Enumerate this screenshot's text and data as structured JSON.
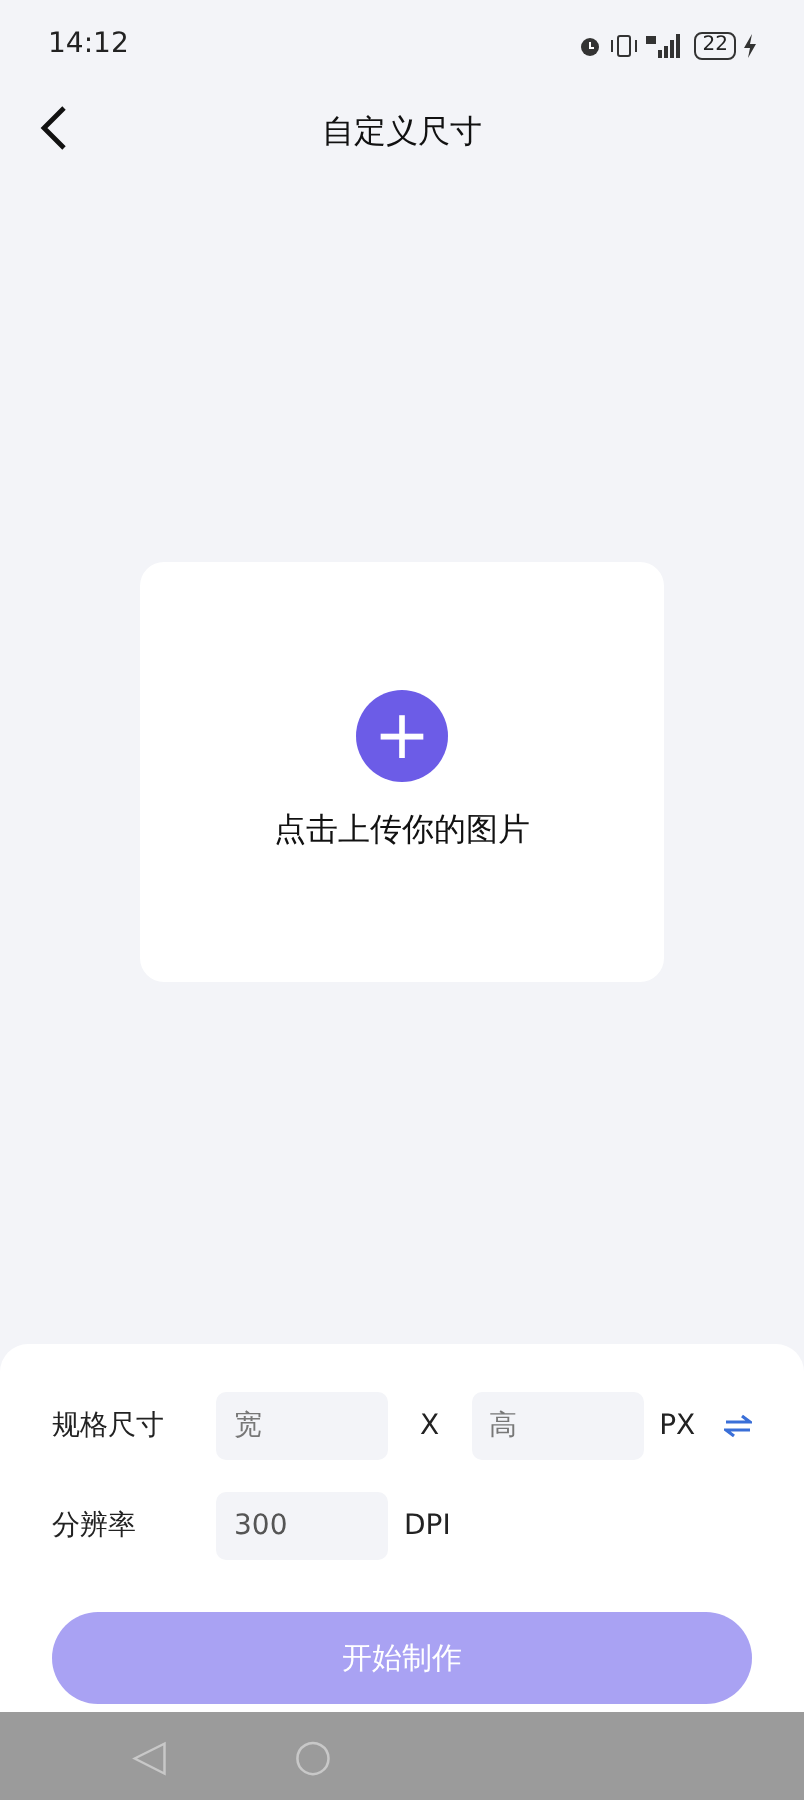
{
  "status_bar": {
    "time": "14:12",
    "battery": "22"
  },
  "header": {
    "title": "自定义尺寸"
  },
  "upload": {
    "plus": "+",
    "label": "点击上传你的图片"
  },
  "form": {
    "size_label": "规格尺寸",
    "width": {
      "placeholder": "宽"
    },
    "separator": "X",
    "height": {
      "placeholder": "高"
    },
    "unit": "PX",
    "resolution_label": "分辨率",
    "resolution": {
      "value": "300"
    },
    "resolution_unit": "DPI"
  },
  "submit": {
    "label": "开始制作",
    "disabled": true
  },
  "nav_bar": {
    "back": "◁",
    "home": "○"
  }
}
